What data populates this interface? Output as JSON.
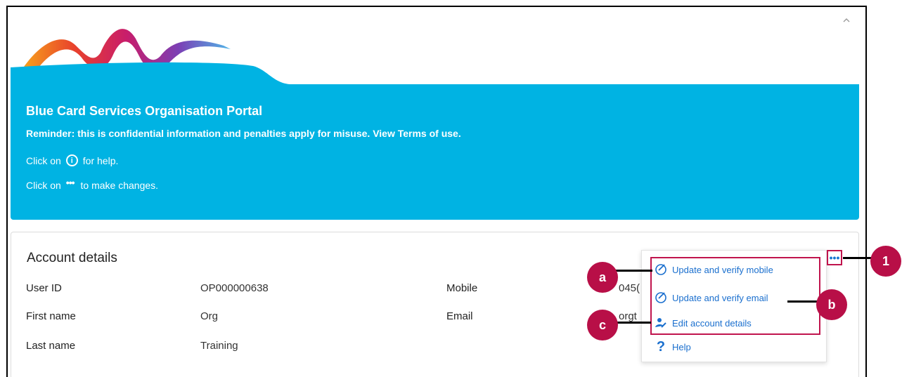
{
  "banner": {
    "title": "Blue Card Services Organisation Portal",
    "reminder": "Reminder: this is confidential information and penalties apply for misuse. View Terms of use.",
    "help_prefix": "Click on",
    "help_suffix": "for help.",
    "changes_prefix": "Click on",
    "changes_suffix": "to make changes.",
    "info_glyph": "i",
    "dots_glyph": "•••"
  },
  "account": {
    "title": "Account details",
    "fields": [
      {
        "label": "User ID",
        "value": "OP000000638"
      },
      {
        "label": "First name",
        "value": "Org"
      },
      {
        "label": "Last name",
        "value": "Training"
      },
      {
        "label": "Mobile",
        "value": "045("
      },
      {
        "label": "Email",
        "value": "orgt"
      }
    ]
  },
  "menu": {
    "more_label": "•••",
    "items": [
      {
        "label": "Update and verify mobile",
        "icon": "check-circle-icon"
      },
      {
        "label": "Update and verify email",
        "icon": "check-circle-icon"
      },
      {
        "label": "Edit account details",
        "icon": "person-edit-icon"
      },
      {
        "label": "Help",
        "icon": "question-icon"
      }
    ]
  },
  "callouts": {
    "one": "1",
    "a": "a",
    "b": "b",
    "c": "c"
  },
  "colors": {
    "banner": "#00b3e3",
    "accent": "#b80f47",
    "link": "#1a6fce"
  }
}
